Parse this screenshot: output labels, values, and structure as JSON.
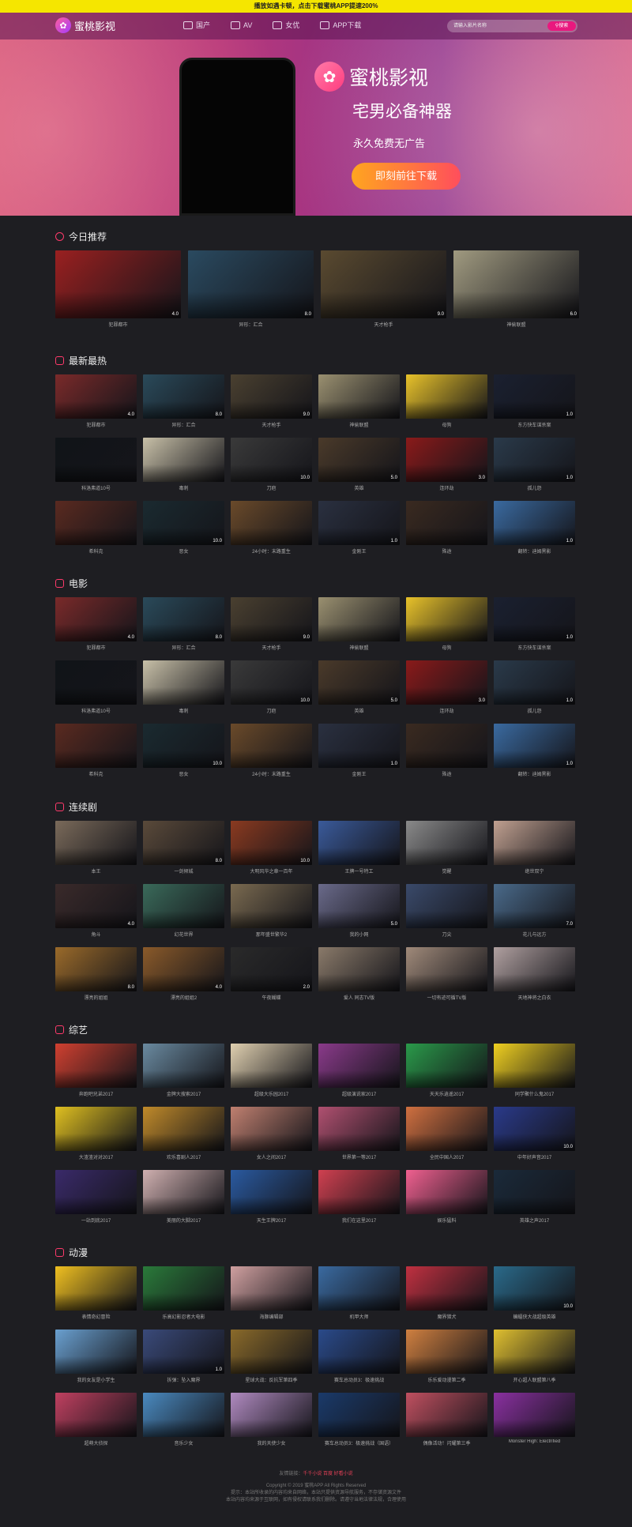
{
  "notice": "播放如遇卡顿，点击下载蜜桃APP提速200%",
  "header": {
    "logo_text": "蜜桃影视",
    "nav": [
      {
        "label": "国产",
        "icon": "tv-icon"
      },
      {
        "label": "AV",
        "icon": "video-icon"
      },
      {
        "label": "女优",
        "icon": "user-icon"
      },
      {
        "label": "APP下载",
        "icon": "phone-icon"
      }
    ],
    "search_placeholder": "请输入影片名称",
    "search_button": "搜索"
  },
  "banner": {
    "logo_text": "蜜桃影视",
    "title": "宅男必备神器",
    "subtitle": "永久免费无广告",
    "button": "即刻前往下载"
  },
  "sections": [
    {
      "title": "今日推荐",
      "layout": "grid4",
      "icon": "clock-icon",
      "items": [
        {
          "title": "犯罪都市",
          "score": "4.0",
          "color": "#9a2020"
        },
        {
          "title": "异形：汇合",
          "score": "8.0",
          "color": "#2a4a60"
        },
        {
          "title": "天才枪手",
          "score": "9.0",
          "color": "#5a4a30"
        },
        {
          "title": "神偷联盟",
          "score": "6.0",
          "color": "#a09a80"
        }
      ]
    },
    {
      "title": "最新最热",
      "layout": "grid6",
      "icon": "tv-icon",
      "items": [
        {
          "title": "犯罪都市",
          "score": "4.0",
          "color": "#7a2a2a"
        },
        {
          "title": "异形：汇合",
          "score": "8.0",
          "color": "#2a4a5a"
        },
        {
          "title": "天才枪手",
          "score": "9.0",
          "color": "#4a4030"
        },
        {
          "title": "神偷联盟",
          "score": "",
          "color": "#9a9070"
        },
        {
          "title": "母狗",
          "score": "",
          "color": "#e8c22a"
        },
        {
          "title": "东方快车谋杀案",
          "score": "1.0",
          "color": "#1a2030"
        },
        {
          "title": "科洛弗道10号",
          "score": "",
          "color": "#101418"
        },
        {
          "title": "毒刺",
          "score": "",
          "color": "#c8c0a8"
        },
        {
          "title": "刀疤",
          "score": "10.0",
          "color": "#3a3a3a"
        },
        {
          "title": "英雄",
          "score": "5.0",
          "color": "#4a3a2a"
        },
        {
          "title": "连环劫",
          "score": "3.0",
          "color": "#8a1a1a"
        },
        {
          "title": "孤儿怨",
          "score": "1.0",
          "color": "#2a3a4a"
        },
        {
          "title": "希科克",
          "score": "",
          "color": "#5a2a20"
        },
        {
          "title": "恶女",
          "score": "10.0",
          "color": "#1a2a30"
        },
        {
          "title": "24小时：末路重生",
          "score": "",
          "color": "#6a4a2a"
        },
        {
          "title": "金刚王",
          "score": "1.0",
          "color": "#2a3040"
        },
        {
          "title": "殊途",
          "score": "",
          "color": "#3a2a20"
        },
        {
          "title": "翻转：迪姆黑影",
          "score": "1.0",
          "color": "#3a6aa0"
        }
      ]
    },
    {
      "title": "电影",
      "layout": "grid6",
      "icon": "film-icon",
      "items": [
        {
          "title": "犯罪都市",
          "score": "4.0",
          "color": "#7a2a2a"
        },
        {
          "title": "异形：汇合",
          "score": "8.0",
          "color": "#2a4a5a"
        },
        {
          "title": "天才枪手",
          "score": "9.0",
          "color": "#4a4030"
        },
        {
          "title": "神偷联盟",
          "score": "",
          "color": "#9a9070"
        },
        {
          "title": "母狗",
          "score": "",
          "color": "#e8c22a"
        },
        {
          "title": "东方快车谋杀案",
          "score": "1.0",
          "color": "#1a2030"
        },
        {
          "title": "科洛弗道10号",
          "score": "",
          "color": "#101418"
        },
        {
          "title": "毒刺",
          "score": "",
          "color": "#c8c0a8"
        },
        {
          "title": "刀疤",
          "score": "10.0",
          "color": "#3a3a3a"
        },
        {
          "title": "英雄",
          "score": "5.0",
          "color": "#4a3a2a"
        },
        {
          "title": "连环劫",
          "score": "3.0",
          "color": "#8a1a1a"
        },
        {
          "title": "孤儿怨",
          "score": "1.0",
          "color": "#2a3a4a"
        },
        {
          "title": "希科克",
          "score": "",
          "color": "#5a2a20"
        },
        {
          "title": "恶女",
          "score": "10.0",
          "color": "#1a2a30"
        },
        {
          "title": "24小时：末路重生",
          "score": "",
          "color": "#6a4a2a"
        },
        {
          "title": "金刚王",
          "score": "1.0",
          "color": "#2a3040"
        },
        {
          "title": "殊途",
          "score": "",
          "color": "#3a2a20"
        },
        {
          "title": "翻转：迪姆黑影",
          "score": "1.0",
          "color": "#3a6aa0"
        }
      ]
    },
    {
      "title": "连续剧",
      "layout": "grid6",
      "icon": "tv-icon",
      "items": [
        {
          "title": "本王",
          "score": "",
          "color": "#7a6a5a"
        },
        {
          "title": "一剑倾城",
          "score": "8.0",
          "color": "#5a4a3a"
        },
        {
          "title": "大明风华之章一百年",
          "score": "10.0",
          "color": "#8a3a20"
        },
        {
          "title": "王牌一号特工",
          "score": "",
          "color": "#3a5a9a"
        },
        {
          "title": "觉醒",
          "score": "",
          "color": "#8a8a8a"
        },
        {
          "title": "绝世双宁",
          "score": "",
          "color": "#c0a090"
        },
        {
          "title": "角斗",
          "score": "4.0",
          "color": "#3a2a2a"
        },
        {
          "title": "幻花世界",
          "score": "",
          "color": "#3a6a5a"
        },
        {
          "title": "那年盛世繁华2",
          "score": "",
          "color": "#7a6a50"
        },
        {
          "title": "我的小网",
          "score": "5.0",
          "color": "#6a6a8a"
        },
        {
          "title": "刀尖",
          "score": "",
          "color": "#3a4a6a"
        },
        {
          "title": "花儿与远方",
          "score": "7.0",
          "color": "#4a6a8a"
        },
        {
          "title": "漂亮的姐姐",
          "score": "8.0",
          "color": "#9a6a2a"
        },
        {
          "title": "漂亮的姐姐2",
          "score": "4.0",
          "color": "#8a5a2a"
        },
        {
          "title": "午夜蝴蝶",
          "score": "2.0",
          "color": "#2a2a2a"
        },
        {
          "title": "爱人 同志TV版",
          "score": "",
          "color": "#8a7a6a"
        },
        {
          "title": "一切有迹可循TV版",
          "score": "",
          "color": "#a08a7a"
        },
        {
          "title": "天地神将之白衣",
          "score": "",
          "color": "#b0a0a0"
        }
      ]
    },
    {
      "title": "综艺",
      "layout": "grid6",
      "icon": "play-icon",
      "items": [
        {
          "title": "奔跑吧兄弟2017",
          "score": "",
          "color": "#d04030"
        },
        {
          "title": "金牌大搜索2017",
          "score": "",
          "color": "#6a8aa0"
        },
        {
          "title": "超级大乐园2017",
          "score": "",
          "color": "#e0d0b0"
        },
        {
          "title": "超级演说家2017",
          "score": "",
          "color": "#8a3a8a"
        },
        {
          "title": "天天乐逍遥2017",
          "score": "",
          "color": "#2a9a4a"
        },
        {
          "title": "同学聚什么鬼2017",
          "score": "",
          "color": "#f0d020"
        },
        {
          "title": "大渣渣对对2017",
          "score": "",
          "color": "#e0c020"
        },
        {
          "title": "欢乐喜剧人2017",
          "score": "",
          "color": "#c08a2a"
        },
        {
          "title": "女人之间2017",
          "score": "",
          "color": "#c08070"
        },
        {
          "title": "世界第一等2017",
          "score": "",
          "color": "#b05070"
        },
        {
          "title": "全民中国人2017",
          "score": "",
          "color": "#d07040"
        },
        {
          "title": "中年好声音2017",
          "score": "10.0",
          "color": "#2a3a8a"
        },
        {
          "title": "一站到底2017",
          "score": "",
          "color": "#3a2a6a"
        },
        {
          "title": "美丽的大脚2017",
          "score": "",
          "color": "#d0b0b0"
        },
        {
          "title": "天生王牌2017",
          "score": "",
          "color": "#2a5aa0"
        },
        {
          "title": "我们在这里2017",
          "score": "",
          "color": "#d04050"
        },
        {
          "title": "娱乐猛料",
          "score": "",
          "color": "#f06090"
        },
        {
          "title": "英雄之声2017",
          "score": "",
          "color": "#1a2a3a"
        }
      ]
    },
    {
      "title": "动漫",
      "layout": "grid6",
      "icon": "play-icon",
      "items": [
        {
          "title": "表情奇幻冒险",
          "score": "",
          "color": "#f0c020"
        },
        {
          "title": "乐高幻影忍者大电影",
          "score": "",
          "color": "#2a7a3a"
        },
        {
          "title": "海豚编辑部",
          "score": "",
          "color": "#d0a0a0"
        },
        {
          "title": "机甲大师",
          "score": "",
          "color": "#3a6aa0"
        },
        {
          "title": "魔界猎犬",
          "score": "",
          "color": "#c03040"
        },
        {
          "title": "蝙蝠侠大战超级英雄",
          "score": "10.0",
          "color": "#2a6a8a"
        },
        {
          "title": "我的女友是小学生",
          "score": "",
          "color": "#6aa0d0"
        },
        {
          "title": "拆弹：坠入魔界",
          "score": "1.0",
          "color": "#3a4a7a"
        },
        {
          "title": "星球大战：反抗军第四季",
          "score": "",
          "color": "#8a6a2a"
        },
        {
          "title": "赛车总动员3：极速挑战",
          "score": "",
          "color": "#2a4a8a"
        },
        {
          "title": "乐乐爱动漫第二季",
          "score": "",
          "color": "#d08040"
        },
        {
          "title": "开心超人联盟第八季",
          "score": "",
          "color": "#e0c030"
        },
        {
          "title": "超萌大侦探",
          "score": "",
          "color": "#c04060"
        },
        {
          "title": "音乐少女",
          "score": "",
          "color": "#4a8ac0"
        },
        {
          "title": "我的天使少女",
          "score": "",
          "color": "#b08ac0"
        },
        {
          "title": "赛车总动员3：极速挑战（国语）",
          "score": "",
          "color": "#1a3a6a"
        },
        {
          "title": "偶像活动！闪耀第三季",
          "score": "",
          "color": "#c05060"
        },
        {
          "title": "Monster High: Electrified",
          "score": "",
          "color": "#8a30a0"
        }
      ]
    }
  ],
  "footer": {
    "line1_label": "友情链接：",
    "line1_hot": "千千小说 百度 好看小说",
    "line2": "Copyright © 2019 蜜桃APP All Rights Reserved",
    "line3": "提示：本站所收录的内容均来自网络，本站只提供资源导航服务，不存储资源文件",
    "line4": "本站内容均来源于互联网，如有侵权请联系我们删除。请遵守当地法律法规，合理使用"
  }
}
